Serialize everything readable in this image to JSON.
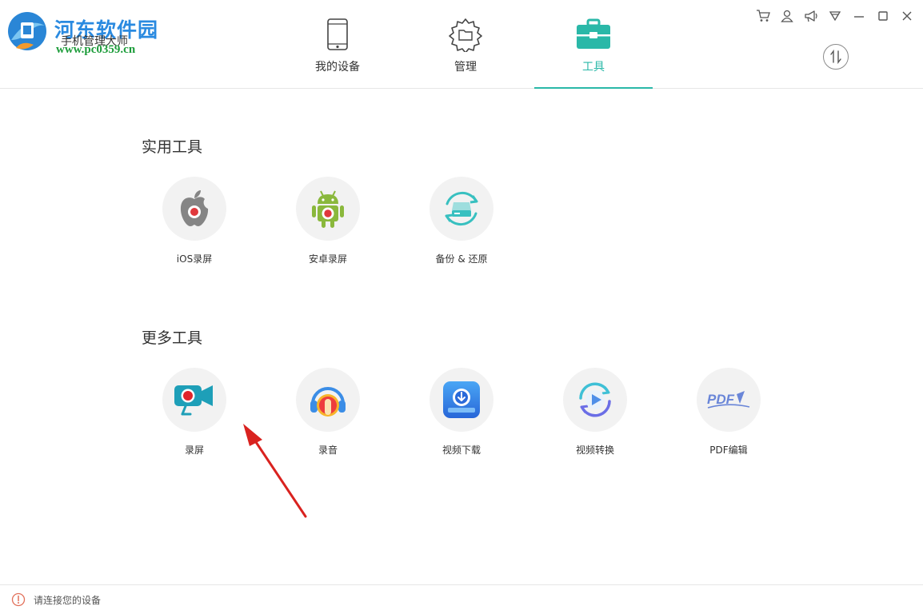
{
  "brand": {
    "watermark": "河东软件园",
    "url": "www.pc0359.cn",
    "app_name": "手机管理大师"
  },
  "tabs": [
    {
      "label": "我的设备",
      "icon": "phone-icon"
    },
    {
      "label": "管理",
      "icon": "gear-folder-icon"
    },
    {
      "label": "工具",
      "icon": "toolbox-icon",
      "active": true
    }
  ],
  "window_controls": [
    "cart-icon",
    "user-icon",
    "megaphone-icon",
    "dropdown-menu-icon",
    "minimize-icon",
    "maximize-icon",
    "close-icon"
  ],
  "sections": {
    "practical": {
      "title": "实用工具",
      "tools": [
        {
          "label": "iOS录屏",
          "icon": "apple-record-icon"
        },
        {
          "label": "安卓录屏",
          "icon": "android-record-icon"
        },
        {
          "label": "备份 & 还原",
          "icon": "backup-restore-icon"
        }
      ]
    },
    "more": {
      "title": "更多工具",
      "tools": [
        {
          "label": "录屏",
          "icon": "screen-record-icon"
        },
        {
          "label": "录音",
          "icon": "audio-record-icon"
        },
        {
          "label": "视频下载",
          "icon": "video-download-icon"
        },
        {
          "label": "视频转换",
          "icon": "video-convert-icon"
        },
        {
          "label": "PDF编辑",
          "icon": "pdf-edit-icon"
        }
      ]
    }
  },
  "pdf_icon_text": "PDF",
  "status": {
    "text": "请连接您的设备"
  },
  "colors": {
    "accent": "#2ab8a8",
    "annotation_arrow": "#d9221f"
  }
}
